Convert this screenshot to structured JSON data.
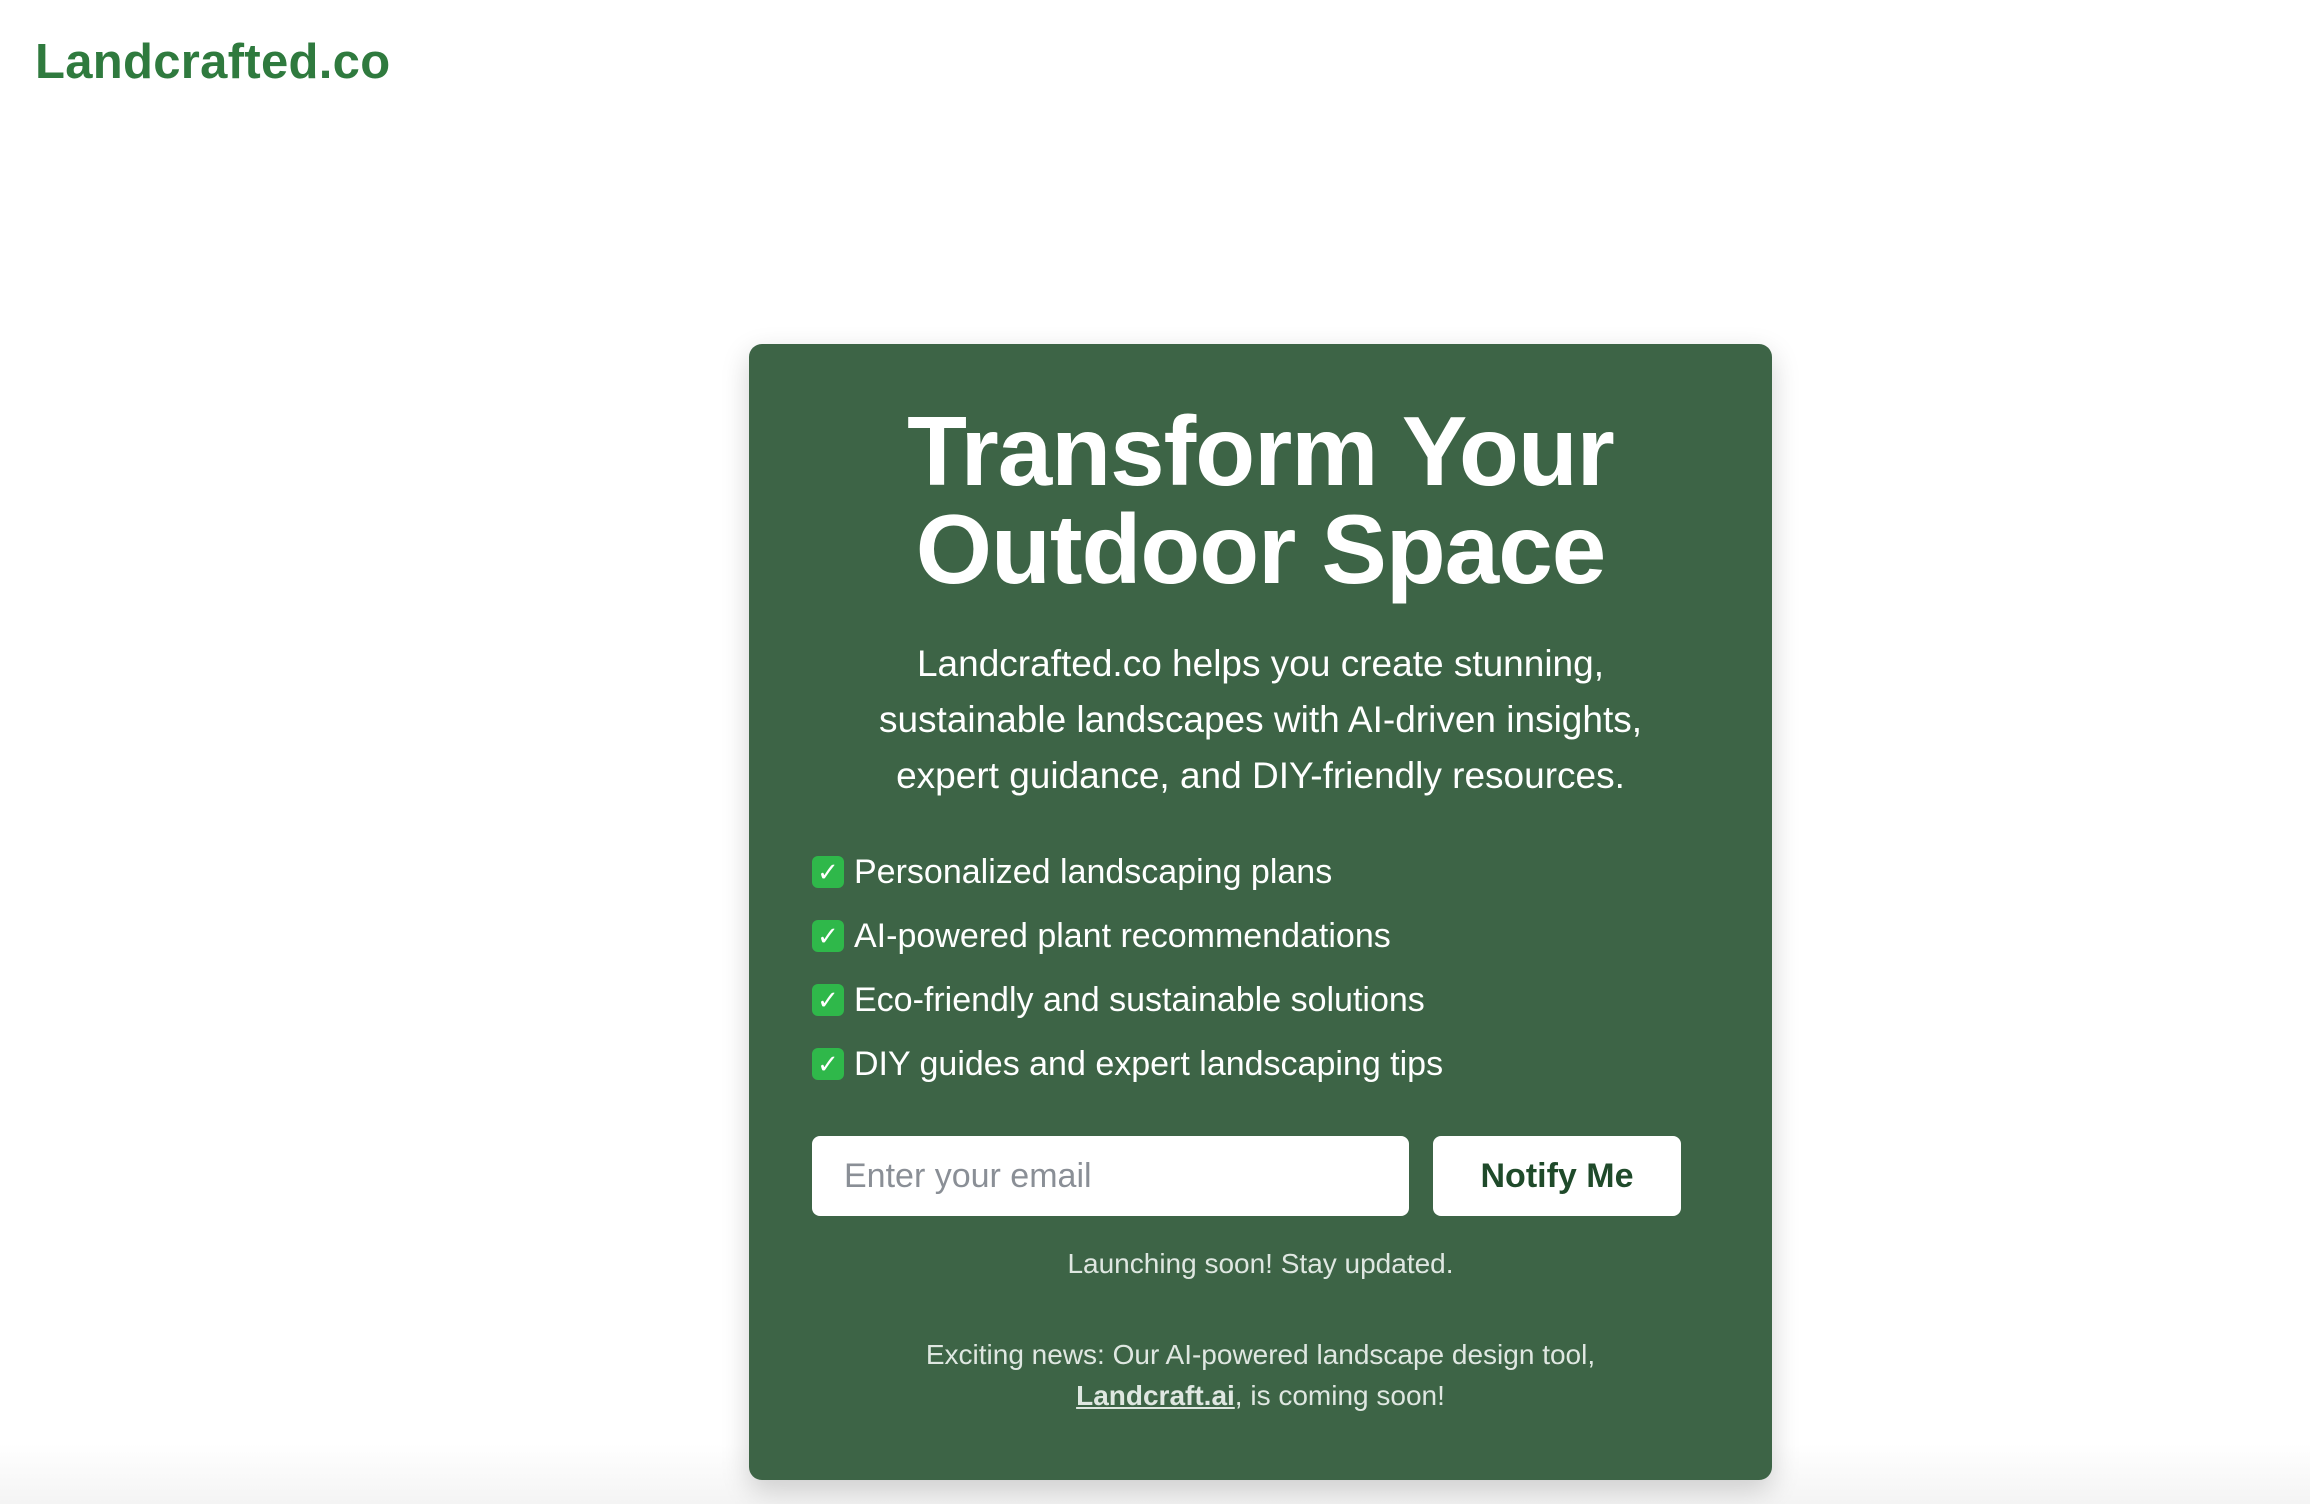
{
  "brand": {
    "logo_text": "Landcrafted.co",
    "logo_color": "#2f7a3e"
  },
  "hero": {
    "card_color": "#3d6446",
    "headline_line1": "Transform Your",
    "headline_line2": "Outdoor Space",
    "intro": "Landcrafted.co helps you create stunning, sustainable landscapes with AI-driven insights, expert guidance, and DIY-friendly resources.",
    "features": [
      {
        "icon": "check-mark-button-icon",
        "label": "Personalized landscaping plans"
      },
      {
        "icon": "check-mark-button-icon",
        "label": "AI-powered plant recommendations"
      },
      {
        "icon": "check-mark-button-icon",
        "label": "Eco-friendly and sustainable solutions"
      },
      {
        "icon": "check-mark-button-icon",
        "label": "DIY guides and expert landscaping tips"
      }
    ]
  },
  "signup": {
    "email_placeholder": "Enter your email",
    "email_value": "",
    "button_label": "Notify Me",
    "status_text": "Launching soon! Stay updated."
  },
  "news": {
    "prefix": "Exciting news: Our AI-powered landscape design tool,",
    "link_text": "Landcraft.ai",
    "suffix": ", is coming soon!"
  }
}
